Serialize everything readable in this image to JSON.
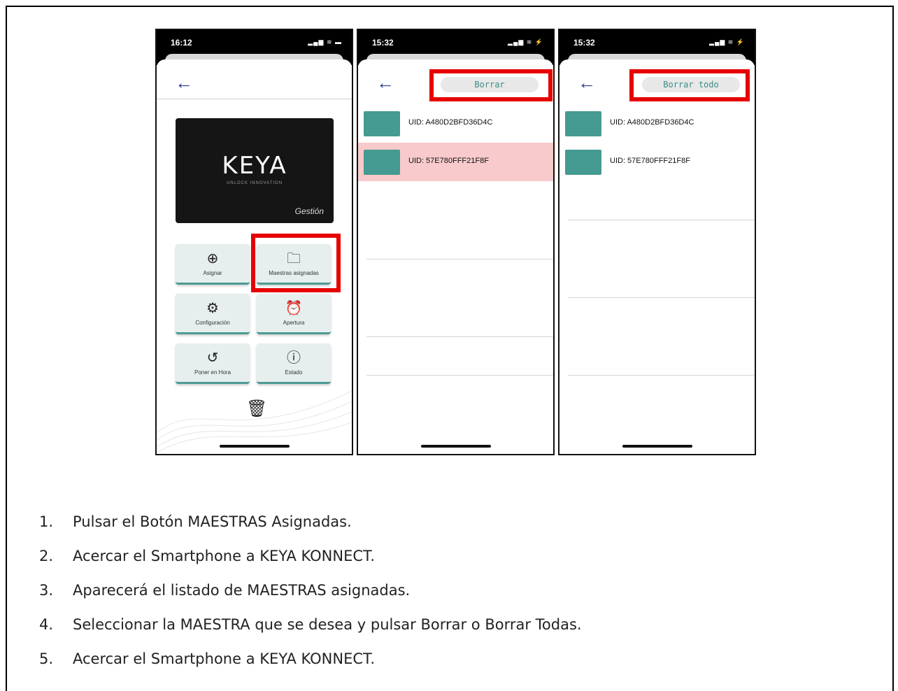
{
  "phone1": {
    "time": "16:12",
    "status_icons": "▂▄▆ ≋ ▬",
    "card": {
      "logo": "KEYA",
      "tagline": "UNLOCK INNOVATION",
      "caption": "Gestión"
    },
    "buttons": [
      {
        "label": "Asignar",
        "icon": "add-user-icon",
        "glyph": "⊕"
      },
      {
        "label": "Maestras asignadas",
        "icon": "folder-user-icon",
        "glyph": "🗀"
      },
      {
        "label": "Configuración",
        "icon": "gear-icon",
        "glyph": "⚙"
      },
      {
        "label": "Apertura",
        "icon": "alarm-clock-icon",
        "glyph": "⏰"
      },
      {
        "label": "Poner en Hora",
        "icon": "history-icon",
        "glyph": "↺"
      },
      {
        "label": "Estado",
        "icon": "info-icon",
        "glyph": "ⓘ"
      }
    ]
  },
  "phone2": {
    "time": "15:32",
    "status_icons": "▂▄▆ ≋ ⚡",
    "action_label": "Borrar",
    "rows": [
      {
        "uid": "UID: A480D2BFD36D4C"
      },
      {
        "uid": "UID: 57E780FFF21F8F"
      }
    ]
  },
  "phone3": {
    "time": "15:32",
    "status_icons": "▂▄▆ ≋ ⚡",
    "action_label": "Borrar todo",
    "rows": [
      {
        "uid": "UID: A480D2BFD36D4C"
      },
      {
        "uid": "UID: 57E780FFF21F8F"
      }
    ]
  },
  "steps": [
    {
      "n": "1.",
      "text": "Pulsar el Botón MAESTRAS Asignadas."
    },
    {
      "n": "2.",
      "text": "Acercar el Smartphone a KEYA KONNECT."
    },
    {
      "n": "3.",
      "text": "Aparecerá el listado de MAESTRAS asignadas."
    },
    {
      "n": "4.",
      "text": "Seleccionar la MAESTRA que se desea y pulsar Borrar o Borrar Todas."
    },
    {
      "n": "5.",
      "text": "Acercar el Smartphone a KEYA KONNECT."
    }
  ],
  "colors": {
    "highlight": "#e60000",
    "accent": "#459a91",
    "selected_row": "#f8cacb",
    "arrow": "#2b3c8f"
  }
}
